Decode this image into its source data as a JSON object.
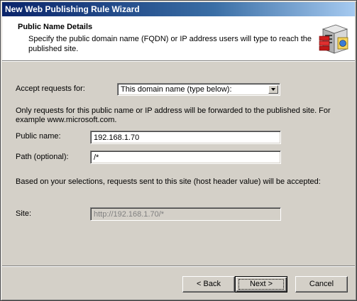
{
  "window": {
    "title": "New Web Publishing Rule Wizard"
  },
  "header": {
    "title": "Public Name Details",
    "description": "Specify the public domain name (FQDN) or IP address users will type to reach the published site.",
    "icon": "wizard-server-icon"
  },
  "form": {
    "accept_label": "Accept requests for:",
    "accept_value": "This domain name (type below):",
    "info_text": "Only requests for this public name or IP address will be forwarded to the published site. For example www.microsoft.com.",
    "public_name_label": "Public name:",
    "public_name_value": "192.168.1.70",
    "path_label": "Path (optional):",
    "path_value": "/*",
    "selection_text": "Based on your selections, requests sent to this site (host header value) will be accepted:",
    "site_label": "Site:",
    "site_value": "http://192.168.1.70/*"
  },
  "buttons": {
    "back": "< Back",
    "next": "Next >",
    "cancel": "Cancel"
  },
  "colors": {
    "title_gradient_start": "#0a246a",
    "title_gradient_end": "#a6caf0",
    "face": "#d4d0c8"
  }
}
